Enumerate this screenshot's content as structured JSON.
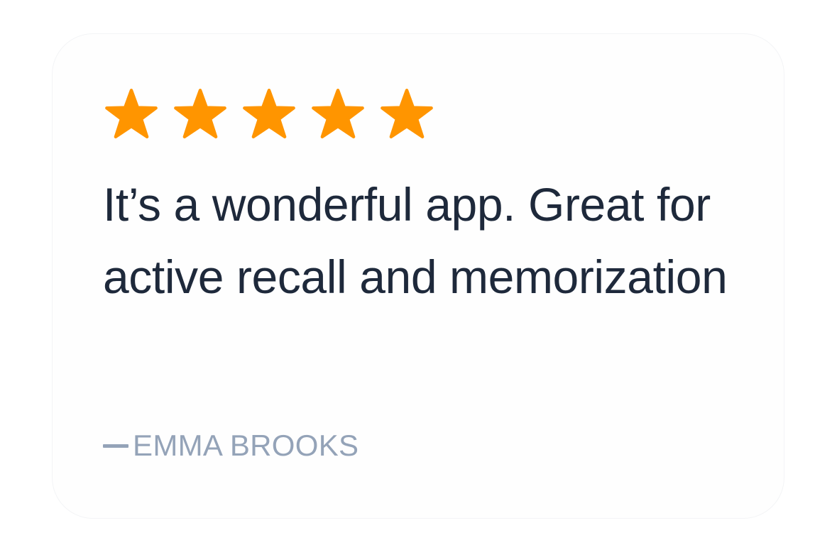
{
  "review": {
    "rating": 5,
    "max_rating": 5,
    "star_color": "#ff9500",
    "quote": "It’s a wonderful app. Great for active recall and memorization",
    "author": "EMMA BROOKS"
  }
}
